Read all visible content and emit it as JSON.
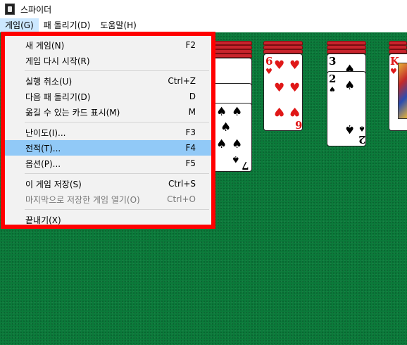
{
  "window": {
    "title": "스파이더"
  },
  "menubar": {
    "items": [
      "게임(G)",
      "패 돌리기(D)",
      "도움말(H)"
    ]
  },
  "game_menu": {
    "groups": [
      [
        {
          "label": "새 게임(N)",
          "shortcut": "F2"
        },
        {
          "label": "게임 다시 시작(R)",
          "shortcut": ""
        }
      ],
      [
        {
          "label": "실행 취소(U)",
          "shortcut": "Ctrl+Z"
        },
        {
          "label": "다음 패 돌리기(D)",
          "shortcut": "D"
        },
        {
          "label": "옮길 수 있는 카드 표시(M)",
          "shortcut": "M"
        }
      ],
      [
        {
          "label": "난이도(I)...",
          "shortcut": "F3"
        },
        {
          "label": "전적(T)...",
          "shortcut": "F4",
          "highlighted": true
        },
        {
          "label": "옵션(P)...",
          "shortcut": "F5"
        }
      ],
      [
        {
          "label": "이 게임 저장(S)",
          "shortcut": "Ctrl+S"
        },
        {
          "label": "마지막으로 저장한 게임 열기(O)",
          "shortcut": "Ctrl+O",
          "disabled": true
        }
      ],
      [
        {
          "label": "끝내기(X)",
          "shortcut": ""
        }
      ]
    ]
  },
  "cards": {
    "col1_rank": "7",
    "col2_rank": "6",
    "col3_ranks": [
      "3",
      "2"
    ],
    "col3_bottom_rank": "2",
    "col4_rank": "K",
    "suits": {
      "spade": "♠",
      "heart": "♥"
    }
  },
  "colors": {
    "felt": "#0b7a3a",
    "menu_highlight": "#91c9f7",
    "annotation_border": "#ff0000"
  }
}
